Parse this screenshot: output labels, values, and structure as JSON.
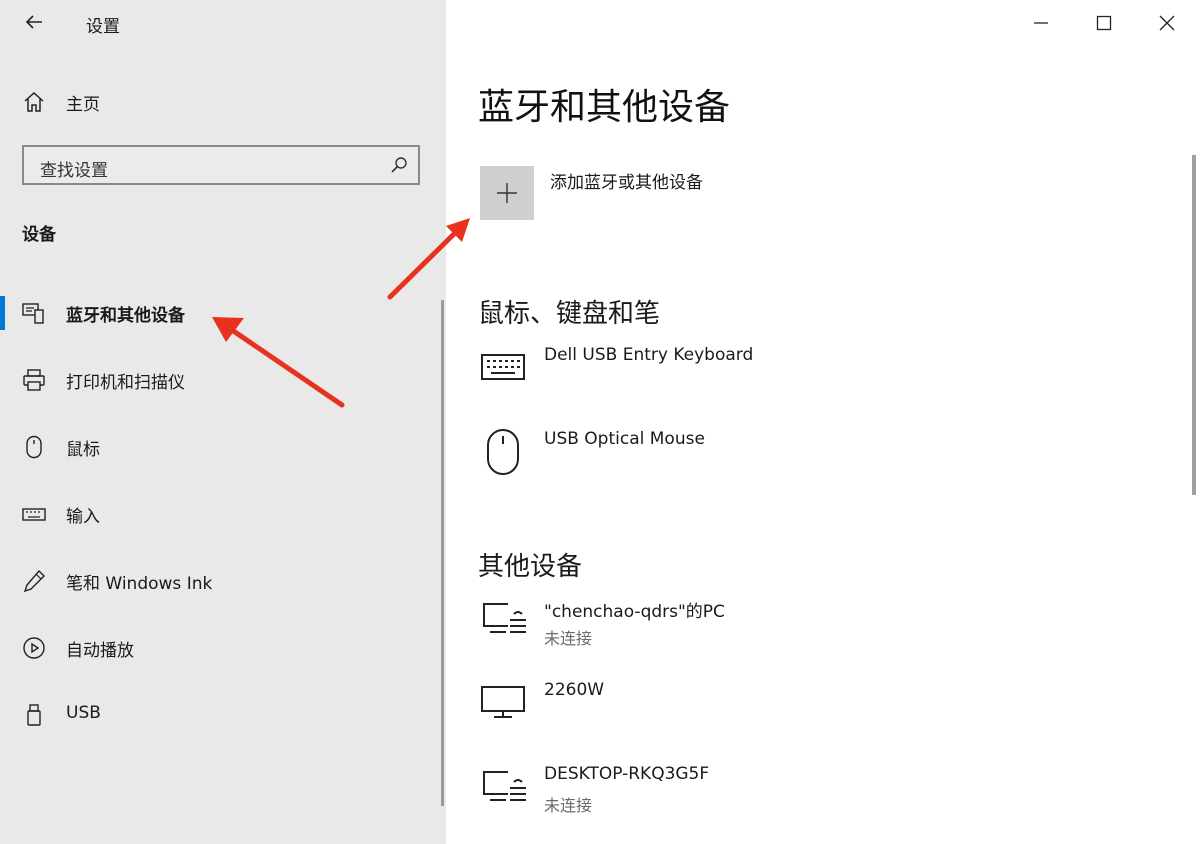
{
  "window": {
    "title": "设置"
  },
  "sidebar": {
    "home_label": "主页",
    "search_placeholder": "查找设置",
    "section_title": "设备",
    "items": [
      {
        "label": "蓝牙和其他设备",
        "icon": "bluetooth-devices-icon",
        "active": true
      },
      {
        "label": "打印机和扫描仪",
        "icon": "printer-icon"
      },
      {
        "label": "鼠标",
        "icon": "mouse-icon"
      },
      {
        "label": "输入",
        "icon": "keyboard-icon"
      },
      {
        "label": "笔和 Windows Ink",
        "icon": "pen-icon"
      },
      {
        "label": "自动播放",
        "icon": "autoplay-icon"
      },
      {
        "label": "USB",
        "icon": "usb-icon"
      }
    ]
  },
  "main": {
    "title": "蓝牙和其他设备",
    "add_device_label": "添加蓝牙或其他设备",
    "sections": [
      {
        "title": "鼠标、键盘和笔",
        "devices": [
          {
            "name": "Dell USB Entry Keyboard",
            "icon": "keyboard-icon"
          },
          {
            "name": "USB Optical Mouse",
            "icon": "mouse-icon"
          }
        ]
      },
      {
        "title": "其他设备",
        "devices": [
          {
            "name": "\"chenchao-qdrs\"的PC",
            "status": "未连接",
            "icon": "pc-wireless-icon"
          },
          {
            "name": "2260W",
            "icon": "monitor-icon"
          },
          {
            "name": "DESKTOP-RKQ3G5F",
            "status": "未连接",
            "icon": "pc-wireless-icon"
          }
        ]
      }
    ]
  },
  "colors": {
    "accent": "#0078d4",
    "annotation_arrow": "#e8321e",
    "sidebar_bg": "#e9e9e9"
  }
}
